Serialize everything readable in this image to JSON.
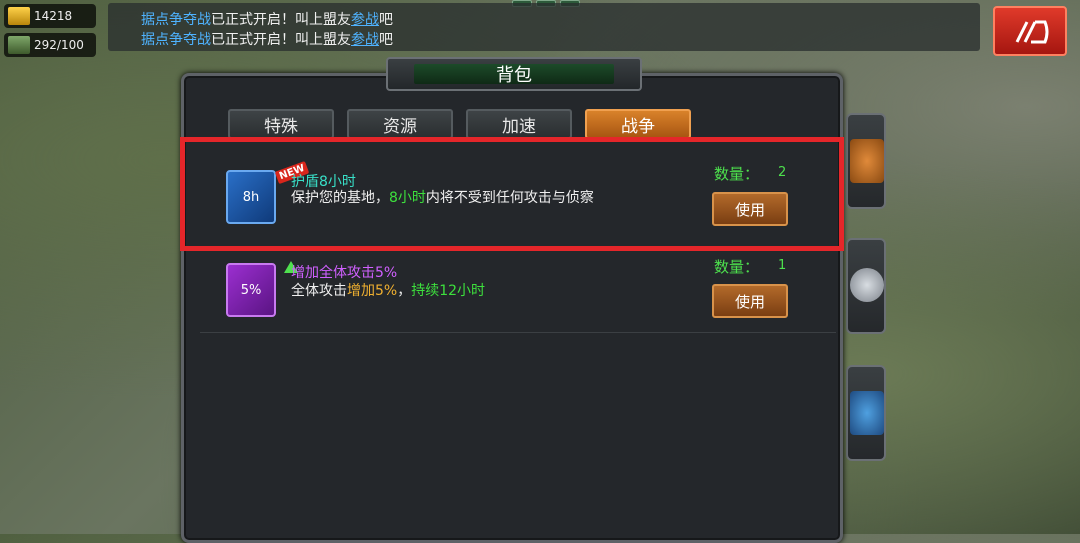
{
  "resources": [
    {
      "icon": "gold-icon",
      "value": "14218"
    },
    {
      "icon": "supply-icon",
      "value": "292/100"
    }
  ],
  "chat": [
    {
      "event": "据点争夺战",
      "text": "已正式开启！叫上盟友",
      "link": "参战",
      "end": "吧"
    },
    {
      "event": "据点争夺战",
      "text": "已正式开启！叫上盟友",
      "link": "参战",
      "end": "吧"
    }
  ],
  "panel": {
    "title": "背包"
  },
  "tabs": [
    {
      "label": "特殊",
      "active": false
    },
    {
      "label": "资源",
      "active": false
    },
    {
      "label": "加速",
      "active": false
    },
    {
      "label": "战争",
      "active": true
    }
  ],
  "items": [
    {
      "name": "护盾8小时",
      "icon": "shield-8h-icon",
      "icon_text": "8h",
      "new_tag": "NEW",
      "desc_a": "保护您的基地，",
      "desc_b": "8小时",
      "desc_c": "内将不受到任何攻击与侦察",
      "qty_label": "数量：",
      "qty": "2",
      "use_label": "使用"
    },
    {
      "name": "增加全体攻击5%",
      "icon": "attack-boost-icon",
      "icon_text": "5%",
      "desc_a": "全体攻击",
      "desc_b": "增加5%",
      "desc_c": "，",
      "desc_d": "持续12小时",
      "qty_label": "数量：",
      "qty": "1",
      "use_label": "使用"
    }
  ],
  "colors": {
    "accent": "#d9822a",
    "highlight": "#e5262a",
    "green": "#3de03d"
  }
}
